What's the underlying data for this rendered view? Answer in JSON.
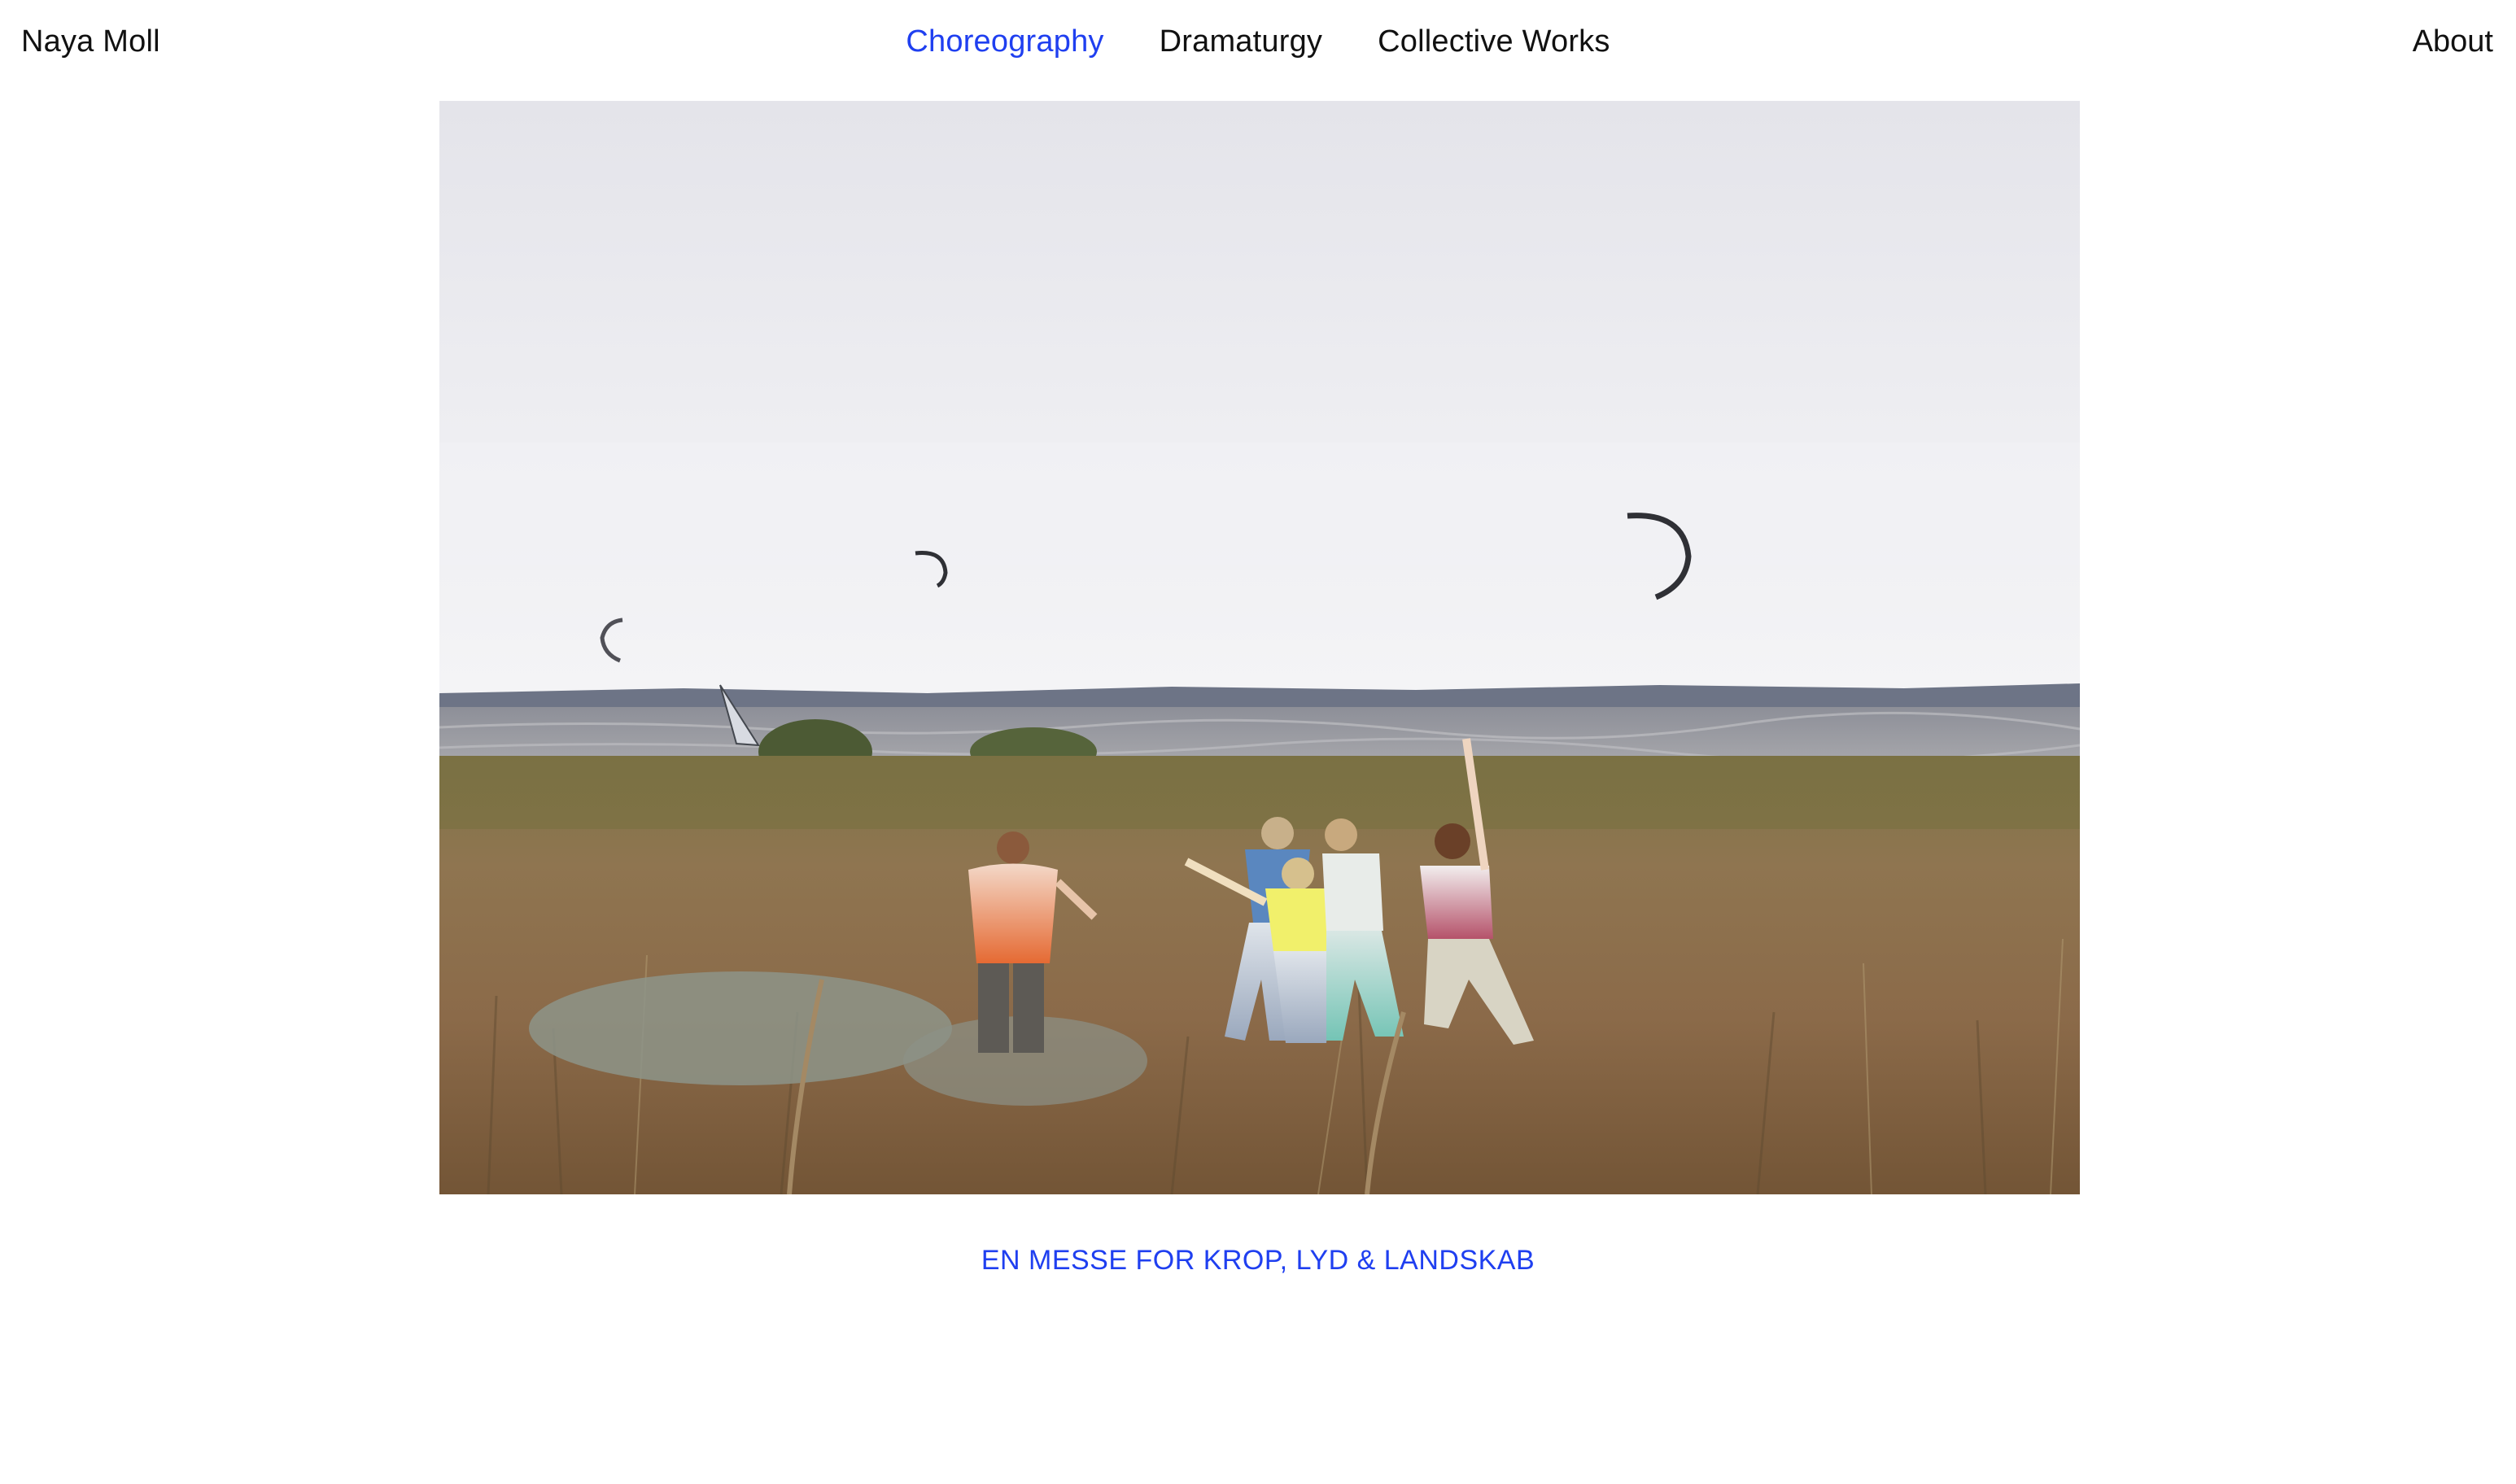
{
  "header": {
    "site_name": "Naya Moll",
    "nav": [
      {
        "label": "Choreography",
        "active": true
      },
      {
        "label": "Dramaturgy",
        "active": false
      },
      {
        "label": "Collective Works",
        "active": false
      }
    ],
    "about_label": "About"
  },
  "main": {
    "photo": {
      "subject": "five dancers in tie-dyed shirts moving in a coastal meadow with kites over the sea",
      "icon": "photo"
    },
    "caption": "EN MESSE FOR KROP, LYD & LANDSKAB"
  },
  "colors": {
    "accent": "#1f3ff0",
    "text": "#111111",
    "background": "#ffffff"
  }
}
